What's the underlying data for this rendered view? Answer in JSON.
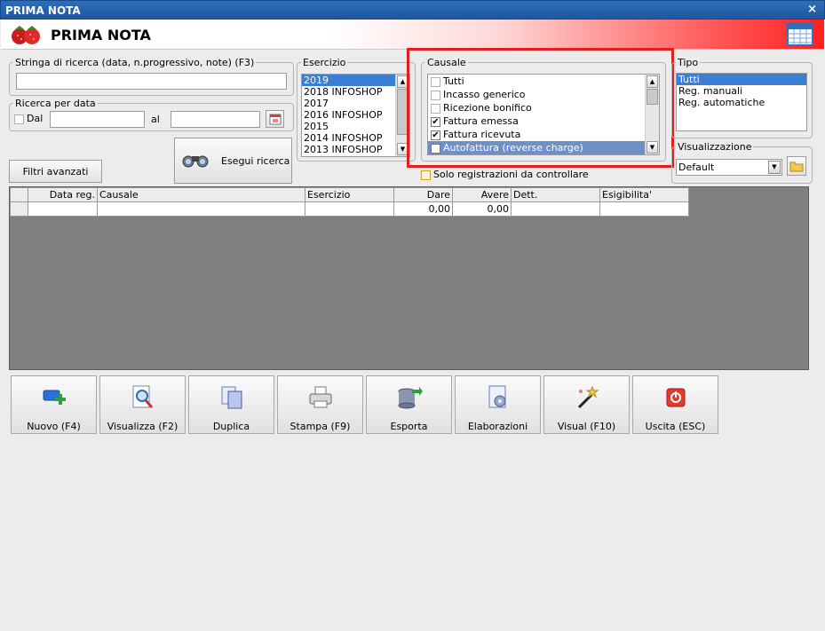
{
  "window": {
    "title": "PRIMA NOTA",
    "close_label": "×"
  },
  "header": {
    "title": "PRIMA NOTA"
  },
  "search": {
    "legend": "Stringa di ricerca (data, n.progressivo, note) (F3)",
    "value": ""
  },
  "date_search": {
    "legend": "Ricerca per data",
    "dal_label": "Dal",
    "al_label": "al",
    "dal_checked": false,
    "dal_value": "",
    "al_value": ""
  },
  "filters_button": "Filtri avanzati",
  "search_button": "Esegui ricerca",
  "esercizio": {
    "legend": "Esercizio",
    "items": [
      "2019",
      "2018 INFOSHOP",
      "2017",
      "2016 INFOSHOP",
      "2015",
      "2014 INFOSHOP",
      "2013 INFOSHOP"
    ],
    "selected": "2019"
  },
  "causale": {
    "legend": "Causale",
    "items": [
      {
        "label": "Tutti",
        "checked": false
      },
      {
        "label": "Incasso generico",
        "checked": false
      },
      {
        "label": "Ricezione bonifico",
        "checked": false
      },
      {
        "label": "Fattura emessa",
        "checked": true
      },
      {
        "label": "Fattura ricevuta",
        "checked": true
      },
      {
        "label": "Autofattura (reverse charge)",
        "checked": true
      }
    ],
    "selected": "Autofattura (reverse charge)"
  },
  "solo_registrazioni": {
    "label": "Solo registrazioni da controllare",
    "checked": false
  },
  "tipo": {
    "legend": "Tipo",
    "items": [
      "Tutti",
      "Reg. manuali",
      "Reg. automatiche"
    ],
    "selected": "Tutti"
  },
  "visualizzazione": {
    "legend": "Visualizzazione",
    "value": "Default"
  },
  "grid": {
    "columns": [
      "",
      "Data reg.",
      "Causale",
      "Esercizio",
      "Dare",
      "Avere",
      "Dett.",
      "Esigibilita'"
    ],
    "rows": [
      [
        "",
        "",
        "",
        "",
        "0,00",
        "0,00",
        "",
        ""
      ]
    ]
  },
  "toolbar": [
    {
      "label": "Nuovo (F4)",
      "icon": "new-icon"
    },
    {
      "label": "Visualizza (F2)",
      "icon": "view-icon"
    },
    {
      "label": "Duplica",
      "icon": "duplicate-icon"
    },
    {
      "label": "Stampa (F9)",
      "icon": "printer-icon"
    },
    {
      "label": "Esporta",
      "icon": "export-icon"
    },
    {
      "label": "Elaborazioni",
      "icon": "process-icon"
    },
    {
      "label": "Visual (F10)",
      "icon": "magic-wand-icon"
    },
    {
      "label": "Uscita (ESC)",
      "icon": "exit-icon"
    }
  ],
  "colors": {
    "titlebar": "#1d57a0",
    "header_accent": "#ff2020",
    "selection": "#3a7fd4",
    "highlight_box": "#e02020"
  }
}
